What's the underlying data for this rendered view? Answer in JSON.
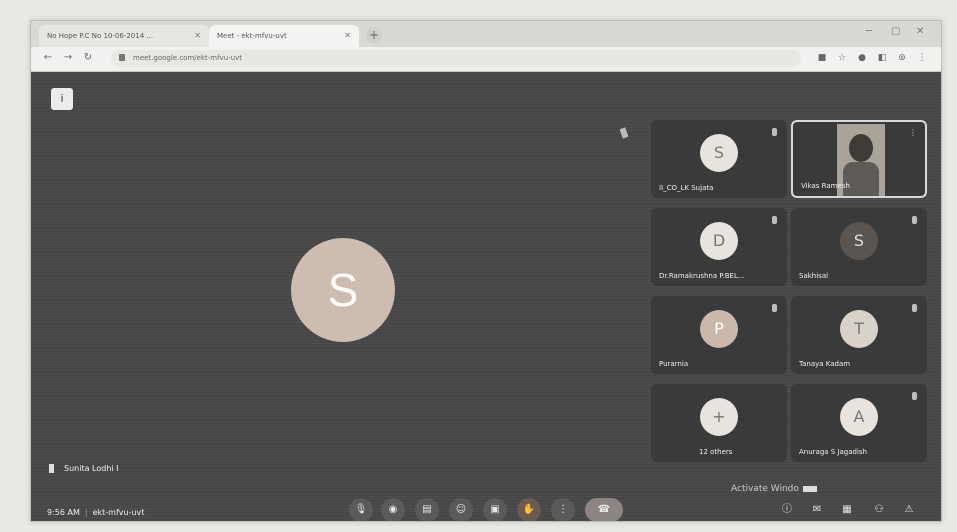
{
  "browser": {
    "tabs": [
      {
        "label": "No Hope  P.C No 10-06-2014 ..."
      },
      {
        "label": "Meet - ekt-mfvu-uvt"
      }
    ],
    "url": "meet.google.com/ekt-mfvu-uvt"
  },
  "meet": {
    "info_glyph": "i",
    "main_initial": "S",
    "self_name": "Sunita Lodhi I",
    "time": "9:56 AM",
    "meeting_code": "ekt-mfvu-uvt",
    "activate_text": "Activate Windo",
    "participants": [
      {
        "name": "II_CO_LK Sujata",
        "initial": "S"
      },
      {
        "name": "Vikas Ramesh",
        "initial": ""
      },
      {
        "name": "Dr.Ramakrushna P.BEL...",
        "initial": "D"
      },
      {
        "name": "Sakhisal",
        "initial": "S"
      },
      {
        "name": "Purarnia",
        "initial": "P"
      },
      {
        "name": "Tanaya Kadam",
        "initial": "T"
      },
      {
        "name": "12 others",
        "initial": "+"
      },
      {
        "name": "Anuraga S Jagadish",
        "initial": "A"
      }
    ],
    "controls": [
      {
        "name": "mic-icon",
        "glyph": "🎙"
      },
      {
        "name": "camera-icon",
        "glyph": "◉"
      },
      {
        "name": "captions-icon",
        "glyph": "▤"
      },
      {
        "name": "emoji-icon",
        "glyph": "☺"
      },
      {
        "name": "present-icon",
        "glyph": "▣"
      },
      {
        "name": "raise-hand-icon",
        "glyph": "✋"
      },
      {
        "name": "more-options-icon",
        "glyph": "⋮"
      },
      {
        "name": "leave-call-icon",
        "glyph": "☎"
      }
    ],
    "right_controls": [
      {
        "name": "info-icon",
        "glyph": "ⓘ"
      },
      {
        "name": "chat-icon",
        "glyph": "✉"
      },
      {
        "name": "activities-icon",
        "glyph": "▦"
      },
      {
        "name": "people-icon",
        "glyph": "⚇"
      },
      {
        "name": "host-controls-icon",
        "glyph": "⚠"
      }
    ]
  }
}
